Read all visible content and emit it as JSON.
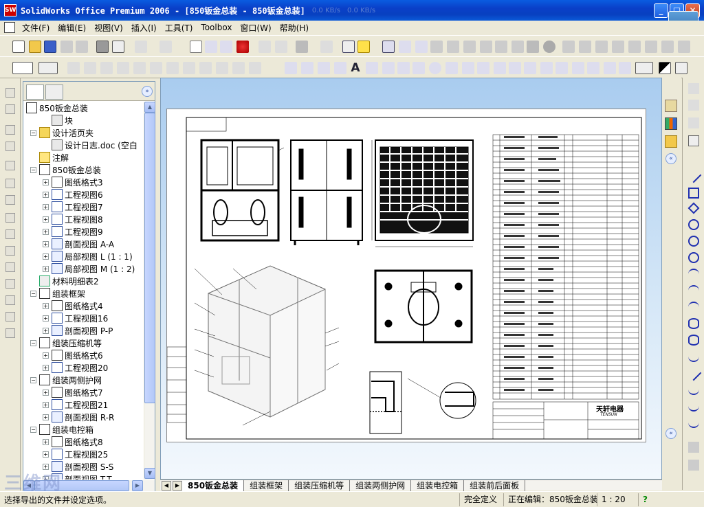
{
  "window": {
    "title": "SolidWorks Office Premium 2006 - [850钣金总装 - 850钣金总装]",
    "net_up": "0.0 KB/s",
    "net_down": "0.0 KB/s",
    "min": "_",
    "max": "□",
    "close": "✕"
  },
  "menu": [
    "文件(F)",
    "编辑(E)",
    "视图(V)",
    "插入(I)",
    "工具(T)",
    "Toolbox",
    "窗口(W)",
    "帮助(H)"
  ],
  "tree": {
    "root": "850钣金总装",
    "items": [
      {
        "label": "块",
        "indent": 1,
        "icon": "block-icon",
        "exp": ""
      },
      {
        "label": "设计活页夹",
        "indent": 0,
        "icon": "binder-icon",
        "exp": "−"
      },
      {
        "label": "设计日志.doc (空白",
        "indent": 1,
        "icon": "doc-icon",
        "exp": ""
      },
      {
        "label": "注解",
        "indent": 0,
        "icon": "annotation-icon",
        "exp": ""
      },
      {
        "label": "850钣金总装",
        "indent": 0,
        "icon": "drawing-icon",
        "exp": "−"
      },
      {
        "label": "图纸格式3",
        "indent": 1,
        "icon": "sheet-format-icon",
        "exp": "+"
      },
      {
        "label": "工程视图6",
        "indent": 1,
        "icon": "drawing-view-icon",
        "exp": "+"
      },
      {
        "label": "工程视图7",
        "indent": 1,
        "icon": "drawing-view-icon",
        "exp": "+"
      },
      {
        "label": "工程视图8",
        "indent": 1,
        "icon": "drawing-view-icon",
        "exp": "+"
      },
      {
        "label": "工程视图9",
        "indent": 1,
        "icon": "drawing-view-icon",
        "exp": "+"
      },
      {
        "label": "剖面视图 A-A",
        "indent": 1,
        "icon": "section-view-icon",
        "exp": "+"
      },
      {
        "label": "局部视图 L (1 : 1)",
        "indent": 1,
        "icon": "detail-view-icon",
        "exp": "+"
      },
      {
        "label": "局部视图 M (1 : 2)",
        "indent": 1,
        "icon": "detail-view-icon",
        "exp": "+"
      },
      {
        "label": "材料明细表2",
        "indent": 0,
        "icon": "bom-icon",
        "exp": ""
      },
      {
        "label": "组装框架",
        "indent": 0,
        "icon": "sheet-icon",
        "exp": "−"
      },
      {
        "label": "图纸格式4",
        "indent": 1,
        "icon": "sheet-format-icon",
        "exp": "+"
      },
      {
        "label": "工程视图16",
        "indent": 1,
        "icon": "drawing-view-icon",
        "exp": "+"
      },
      {
        "label": "剖面视图 P-P",
        "indent": 1,
        "icon": "section-view-icon",
        "exp": "+"
      },
      {
        "label": "组装压缩机等",
        "indent": 0,
        "icon": "sheet-icon",
        "exp": "−"
      },
      {
        "label": "图纸格式6",
        "indent": 1,
        "icon": "sheet-format-icon",
        "exp": "+"
      },
      {
        "label": "工程视图20",
        "indent": 1,
        "icon": "drawing-view-icon",
        "exp": "+"
      },
      {
        "label": "组装两侧护网",
        "indent": 0,
        "icon": "sheet-icon",
        "exp": "−"
      },
      {
        "label": "图纸格式7",
        "indent": 1,
        "icon": "sheet-format-icon",
        "exp": "+"
      },
      {
        "label": "工程视图21",
        "indent": 1,
        "icon": "drawing-view-icon",
        "exp": "+"
      },
      {
        "label": "剖面视图 R-R",
        "indent": 1,
        "icon": "section-view-icon",
        "exp": "+"
      },
      {
        "label": "组装电控箱",
        "indent": 0,
        "icon": "sheet-icon",
        "exp": "−"
      },
      {
        "label": "图纸格式8",
        "indent": 1,
        "icon": "sheet-format-icon",
        "exp": "+"
      },
      {
        "label": "工程视图25",
        "indent": 1,
        "icon": "drawing-view-icon",
        "exp": "+"
      },
      {
        "label": "剖面视图 S-S",
        "indent": 1,
        "icon": "section-view-icon",
        "exp": "+"
      },
      {
        "label": "剖面视图 T-T",
        "indent": 1,
        "icon": "section-view-icon",
        "exp": "+"
      }
    ]
  },
  "sheet_tabs": [
    "850钣金总装",
    "组装框架",
    "组装压缩机等",
    "组装两侧护网",
    "组装电控箱",
    "组装前后面板"
  ],
  "status": {
    "message": "选择导出的文件并设定选项。",
    "define": "完全定义",
    "editing": "正在编辑：850钣金总装",
    "scale": "1 : 20",
    "help": "?"
  },
  "titleblock": {
    "company": "天轩电器",
    "brand": "TENSUN"
  },
  "watermark": "三维网"
}
